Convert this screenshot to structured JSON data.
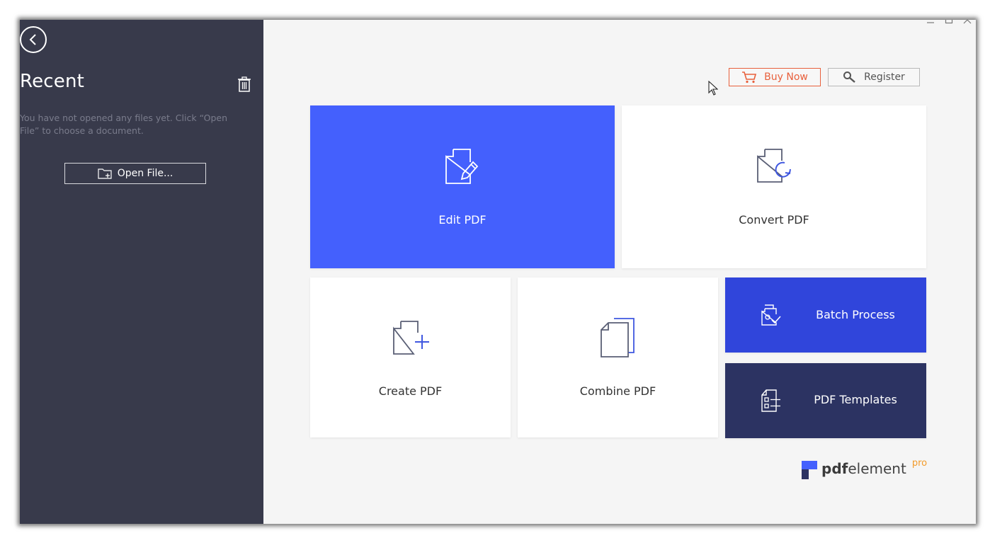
{
  "sidebar": {
    "title": "Recent",
    "empty_message": "You have not opened any files yet. Click “Open File” to choose a document.",
    "open_file_label": "Open File..."
  },
  "header": {
    "buy_label": "Buy Now",
    "register_label": "Register"
  },
  "tiles": {
    "edit": "Edit PDF",
    "convert": "Convert PDF",
    "create": "Create PDF",
    "combine": "Combine PDF",
    "batch": "Batch Process",
    "templates": "PDF Templates"
  },
  "logo": {
    "bold": "pdf",
    "regular": "element",
    "suffix": "pro"
  },
  "colors": {
    "sidebar": "#383a4b",
    "edit_tile": "#4460fd",
    "batch_tile": "#3045db",
    "templates_tile": "#2c3362",
    "buy_accent": "#e8603c",
    "pro_accent": "#f39b2a"
  }
}
